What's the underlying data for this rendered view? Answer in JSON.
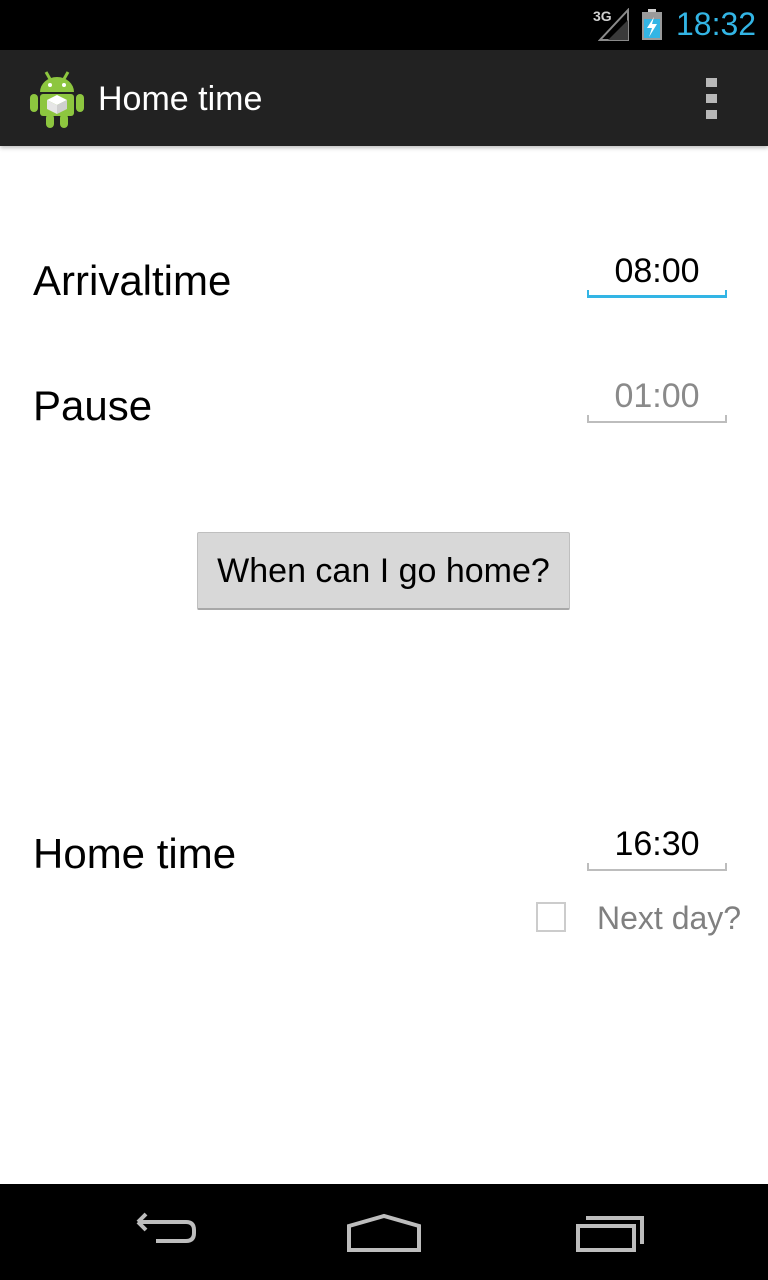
{
  "status_bar": {
    "network": "3G",
    "time": "18:32",
    "icons": [
      "signal-icon",
      "battery-charging-icon"
    ]
  },
  "action_bar": {
    "app_icon": "android-robot-icon",
    "title": "Home time",
    "overflow_icon": "overflow-menu-icon"
  },
  "form": {
    "arrival": {
      "label": "Arrivaltime",
      "value": "08:00",
      "focused": true
    },
    "pause": {
      "label": "Pause",
      "value": "01:00",
      "focused": false
    },
    "calc_button": {
      "label": "When can I go home?"
    },
    "home_time": {
      "label": "Home time",
      "value": "16:30"
    },
    "next_day": {
      "label": "Next day?",
      "checked": false
    }
  },
  "nav_bar": {
    "icons": [
      "back-icon",
      "home-icon",
      "recent-apps-icon"
    ]
  },
  "colors": {
    "accent": "#33b5e5",
    "action_bar": "#222222",
    "field_value": "#000000",
    "field_hint": "#8a8a8a",
    "secondary_text": "#808080"
  }
}
